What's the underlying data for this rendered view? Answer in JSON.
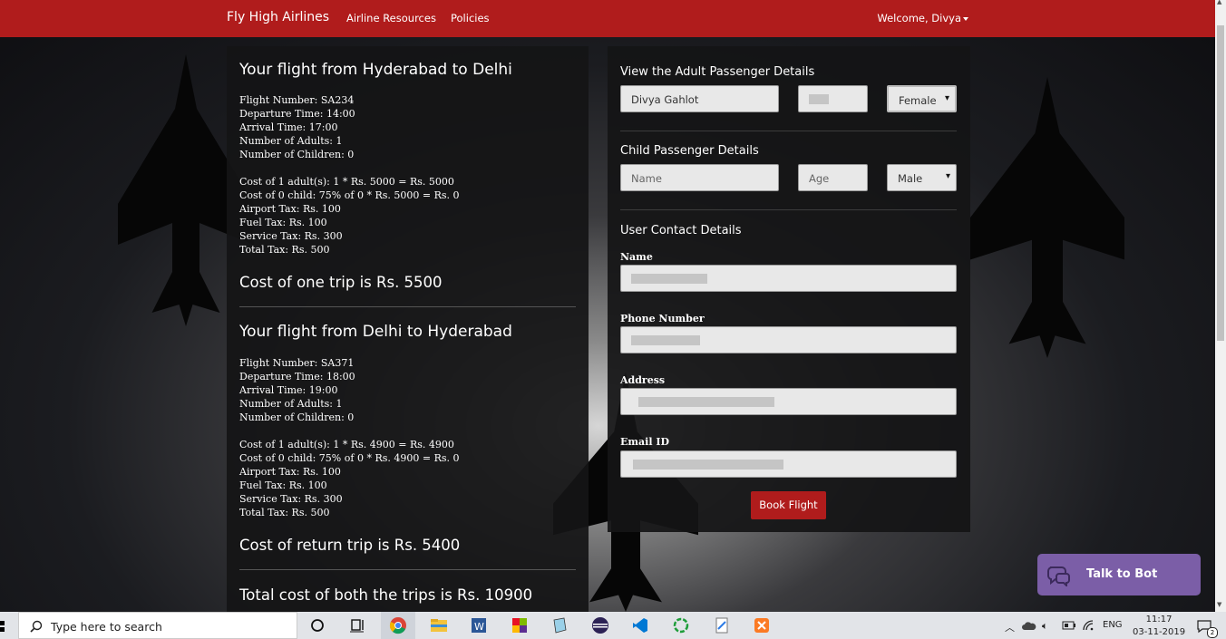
{
  "navbar": {
    "brand": "Fly High Airlines",
    "links": [
      "Airline Resources",
      "Policies"
    ],
    "welcome": "Welcome, Divya"
  },
  "trips": [
    {
      "title": "Your flight from Hyderabad to Delhi",
      "flight_number": "Flight Number: SA234",
      "departure": "Departure Time: 14:00",
      "arrival": "Arrival Time: 17:00",
      "adults": "Number of Adults: 1",
      "children": "Number of Children: 0",
      "cost_adult": "Cost of 1 adult(s): 1 * Rs. 5000 = Rs. 5000",
      "cost_child": "Cost of 0 child: 75% of 0 * Rs. 5000 = Rs. 0",
      "airport_tax": "Airport Tax: Rs. 100",
      "fuel_tax": "Fuel Tax: Rs. 100",
      "service_tax": "Service Tax: Rs. 300",
      "total_tax": "Total Tax: Rs. 500",
      "trip_cost": "Cost of one trip is Rs. 5500"
    },
    {
      "title": "Your flight from Delhi to Hyderabad",
      "flight_number": "Flight Number: SA371",
      "departure": "Departure Time: 18:00",
      "arrival": "Arrival Time: 19:00",
      "adults": "Number of Adults: 1",
      "children": "Number of Children: 0",
      "cost_adult": "Cost of 1 adult(s): 1 * Rs. 4900 = Rs. 4900",
      "cost_child": "Cost of 0 child: 75% of 0 * Rs. 4900 = Rs. 0",
      "airport_tax": "Airport Tax: Rs. 100",
      "fuel_tax": "Fuel Tax: Rs. 100",
      "service_tax": "Service Tax: Rs. 300",
      "total_tax": "Total Tax: Rs. 500",
      "trip_cost": "Cost of return trip is Rs. 5400"
    }
  ],
  "total_cost": "Total cost of both the trips is Rs. 10900",
  "form": {
    "adult_title": "View the Adult Passenger Details",
    "adult_name": "Divya Gahlot",
    "adult_gender": "Female",
    "child_title": "Child Passenger Details",
    "child_name_placeholder": "Name",
    "child_age_placeholder": "Age",
    "child_gender": "Male",
    "contact_title": "User Contact Details",
    "name_label": "Name",
    "phone_label": "Phone Number",
    "address_label": "Address",
    "email_label": "Email ID",
    "book_button": "Book Flight"
  },
  "bot": {
    "label": "Talk to Bot",
    "color": "#7b5ea7"
  },
  "taskbar": {
    "search_placeholder": "Type here to search",
    "language": "ENG",
    "time": "11:17",
    "date": "03-11-2019",
    "notifications": "2"
  },
  "colors": {
    "brand": "#b01c1c",
    "panel": "#141416"
  }
}
